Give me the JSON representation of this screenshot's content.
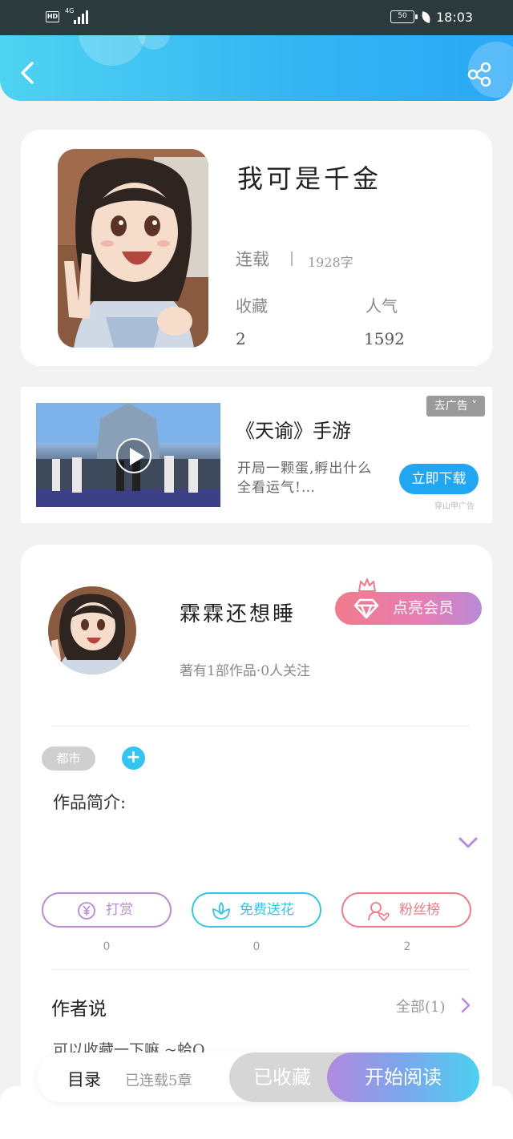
{
  "status_bar": {
    "hd": "HD",
    "network": "4G",
    "battery": "50",
    "time": "18:03"
  },
  "header": {
    "back_icon": "chevron-left-icon",
    "share_icon": "share-icon"
  },
  "book": {
    "title": "我可是千金",
    "status": "连载",
    "word_count": "1928字",
    "favorites_label": "收藏",
    "popularity_label": "人气",
    "favorites_value": "2",
    "popularity_value": "1592"
  },
  "ad": {
    "title": "《天谕》手游",
    "description": "开局一颗蛋,孵出什么全看运气!…",
    "remove_label": "去广告 ˅",
    "download_label": "立即下载",
    "source": "穿山甲广告"
  },
  "author": {
    "name": "霖霖还想睡",
    "vip_label": "点亮会员",
    "works_info": "著有1部作品·0人关注",
    "tag": "都市",
    "add_tag_symbol": "+",
    "intro_label": "作品简介:"
  },
  "actions": [
    {
      "label": "打赏",
      "count": "0",
      "icon": "yen-icon",
      "color": "#b98ad8"
    },
    {
      "label": "免费送花",
      "count": "0",
      "icon": "flower-icon",
      "color": "#36c4ea"
    },
    {
      "label": "粉丝榜",
      "count": "2",
      "icon": "fans-icon",
      "color": "#ee7b87"
    }
  ],
  "author_says": {
    "label": "作者说",
    "all_label": "全部(1)",
    "message": "可以收藏一下嘛 ~蛤Q"
  },
  "bottom_bar": {
    "toc_label": "目录",
    "toc_status": "已连载5章",
    "favorited_label": "已收藏",
    "read_label": "开始阅读"
  },
  "colors": {
    "accent_blue": "#22a6f2",
    "vip_pink": "#f07b8a",
    "tag_cyan": "#35c4ef"
  }
}
